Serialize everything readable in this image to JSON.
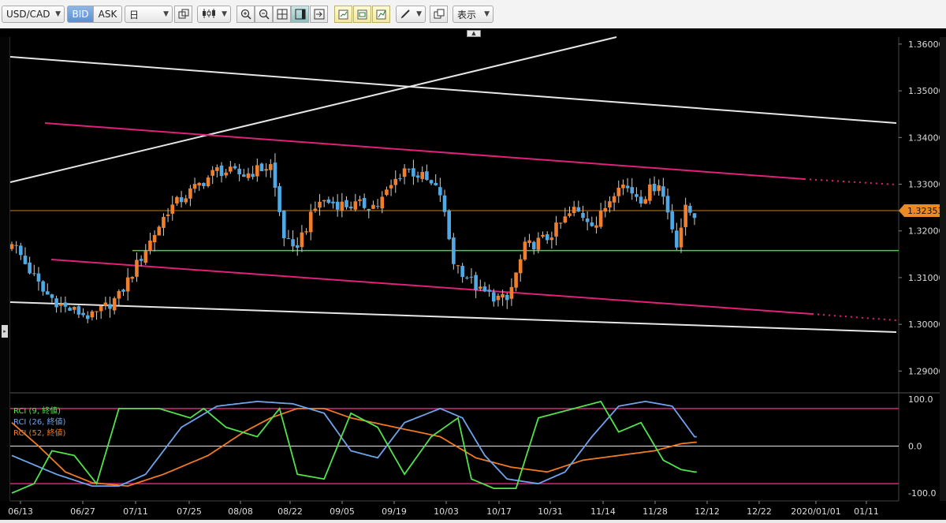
{
  "toolbar": {
    "symbol": "USD/CAD",
    "bid_label": "BID",
    "ask_label": "ASK",
    "timeframe": "日",
    "display_label": "表示",
    "buttons": [
      "link-chart-icon",
      "candlestick-icon",
      "zoom-in-icon",
      "zoom-out-icon",
      "crosshair-icon",
      "chart-panel-icon",
      "scroll-end-icon",
      "draw-trend-icon",
      "draw-channel-icon",
      "draw-fib-icon",
      "pen-icon",
      "copy-window-icon"
    ]
  },
  "colors": {
    "up_candle": "#ef7f2a",
    "down_candle": "#4ea9e6",
    "pink_channel": "#e0207a",
    "green_support": "#3bd83b",
    "price_line": "#c77b1e",
    "rci9": "#52e24d",
    "rci26": "#6fa4ec",
    "rci52": "#f07a22"
  },
  "price_axis": {
    "labels": [
      "1.36000",
      "1.35000",
      "1.34000",
      "1.33000",
      "1.32000",
      "1.31000",
      "1.30000",
      "1.29000"
    ],
    "current_price": "1.32353"
  },
  "date_axis": {
    "labels": [
      "06/13",
      "06/27",
      "07/11",
      "07/25",
      "08/08",
      "08/22",
      "09/05",
      "09/19",
      "10/03",
      "10/17",
      "10/31",
      "11/14",
      "11/28",
      "12/12",
      "12/22",
      "2020/01/01",
      "01/11"
    ]
  },
  "indicator": {
    "legend": [
      "RCI (9, 終値)",
      "RCI (26, 終値)",
      "RCI (52, 終値)"
    ],
    "axis_labels": [
      "100.0",
      "0.0",
      "-100.0"
    ]
  },
  "chart_data": {
    "type": "candlestick",
    "symbol": "USD/CAD",
    "ylim": [
      1.2855,
      1.3615
    ],
    "pivots": [
      [
        0,
        1.318
      ],
      [
        3,
        1.313
      ],
      [
        7,
        1.307
      ],
      [
        12,
        1.3035
      ],
      [
        18,
        1.3015
      ],
      [
        24,
        1.306
      ],
      [
        35,
        1.3245
      ],
      [
        46,
        1.333
      ],
      [
        52,
        1.332
      ],
      [
        58,
        1.334
      ],
      [
        61,
        1.319
      ],
      [
        63,
        1.3155
      ],
      [
        69,
        1.3265
      ],
      [
        75,
        1.3255
      ],
      [
        82,
        1.3255
      ],
      [
        88,
        1.3335
      ],
      [
        92,
        1.3315
      ],
      [
        96,
        1.328
      ],
      [
        99,
        1.3135
      ],
      [
        105,
        1.307
      ],
      [
        111,
        1.305
      ],
      [
        115,
        1.3165
      ],
      [
        120,
        1.3185
      ],
      [
        126,
        1.3245
      ],
      [
        131,
        1.3215
      ],
      [
        136,
        1.3305
      ],
      [
        141,
        1.327
      ],
      [
        145,
        1.3305
      ],
      [
        149,
        1.3175
      ],
      [
        151,
        1.3245
      ],
      [
        153,
        1.3235
      ]
    ],
    "current_price": 1.32353,
    "horizontal_support": 1.3158,
    "rci9_pivots": [
      [
        0,
        -100
      ],
      [
        5,
        -80
      ],
      [
        9,
        -10
      ],
      [
        14,
        -20
      ],
      [
        19,
        -80
      ],
      [
        24,
        80
      ],
      [
        33,
        80
      ],
      [
        40,
        60
      ],
      [
        43,
        80
      ],
      [
        48,
        40
      ],
      [
        55,
        20
      ],
      [
        60,
        80
      ],
      [
        64,
        -60
      ],
      [
        70,
        -70
      ],
      [
        76,
        70
      ],
      [
        82,
        40
      ],
      [
        88,
        -60
      ],
      [
        94,
        20
      ],
      [
        100,
        60
      ],
      [
        103,
        -70
      ],
      [
        108,
        -90
      ],
      [
        113,
        -90
      ],
      [
        118,
        60
      ],
      [
        126,
        80
      ],
      [
        132,
        95
      ],
      [
        136,
        30
      ],
      [
        141,
        50
      ],
      [
        146,
        -30
      ],
      [
        150,
        -50
      ],
      [
        153,
        -55
      ]
    ],
    "rci26_pivots": [
      [
        0,
        -20
      ],
      [
        10,
        -60
      ],
      [
        18,
        -85
      ],
      [
        24,
        -85
      ],
      [
        30,
        -60
      ],
      [
        38,
        40
      ],
      [
        46,
        85
      ],
      [
        55,
        95
      ],
      [
        63,
        90
      ],
      [
        70,
        70
      ],
      [
        76,
        -10
      ],
      [
        82,
        -25
      ],
      [
        88,
        50
      ],
      [
        96,
        80
      ],
      [
        101,
        60
      ],
      [
        106,
        -20
      ],
      [
        111,
        -70
      ],
      [
        118,
        -80
      ],
      [
        124,
        -55
      ],
      [
        130,
        20
      ],
      [
        136,
        85
      ],
      [
        142,
        95
      ],
      [
        148,
        85
      ],
      [
        153,
        20
      ]
    ],
    "rci52_pivots": [
      [
        0,
        50
      ],
      [
        6,
        0
      ],
      [
        12,
        -55
      ],
      [
        18,
        -78
      ],
      [
        26,
        -85
      ],
      [
        34,
        -60
      ],
      [
        44,
        -20
      ],
      [
        52,
        30
      ],
      [
        58,
        60
      ],
      [
        64,
        80
      ],
      [
        70,
        80
      ],
      [
        76,
        60
      ],
      [
        86,
        40
      ],
      [
        96,
        20
      ],
      [
        104,
        -25
      ],
      [
        112,
        -45
      ],
      [
        120,
        -55
      ],
      [
        128,
        -30
      ],
      [
        136,
        -20
      ],
      [
        144,
        -10
      ],
      [
        150,
        5
      ],
      [
        153,
        8
      ]
    ],
    "rci_ylim": [
      -110,
      110
    ],
    "rci_levels": [
      80,
      0,
      -80
    ]
  }
}
